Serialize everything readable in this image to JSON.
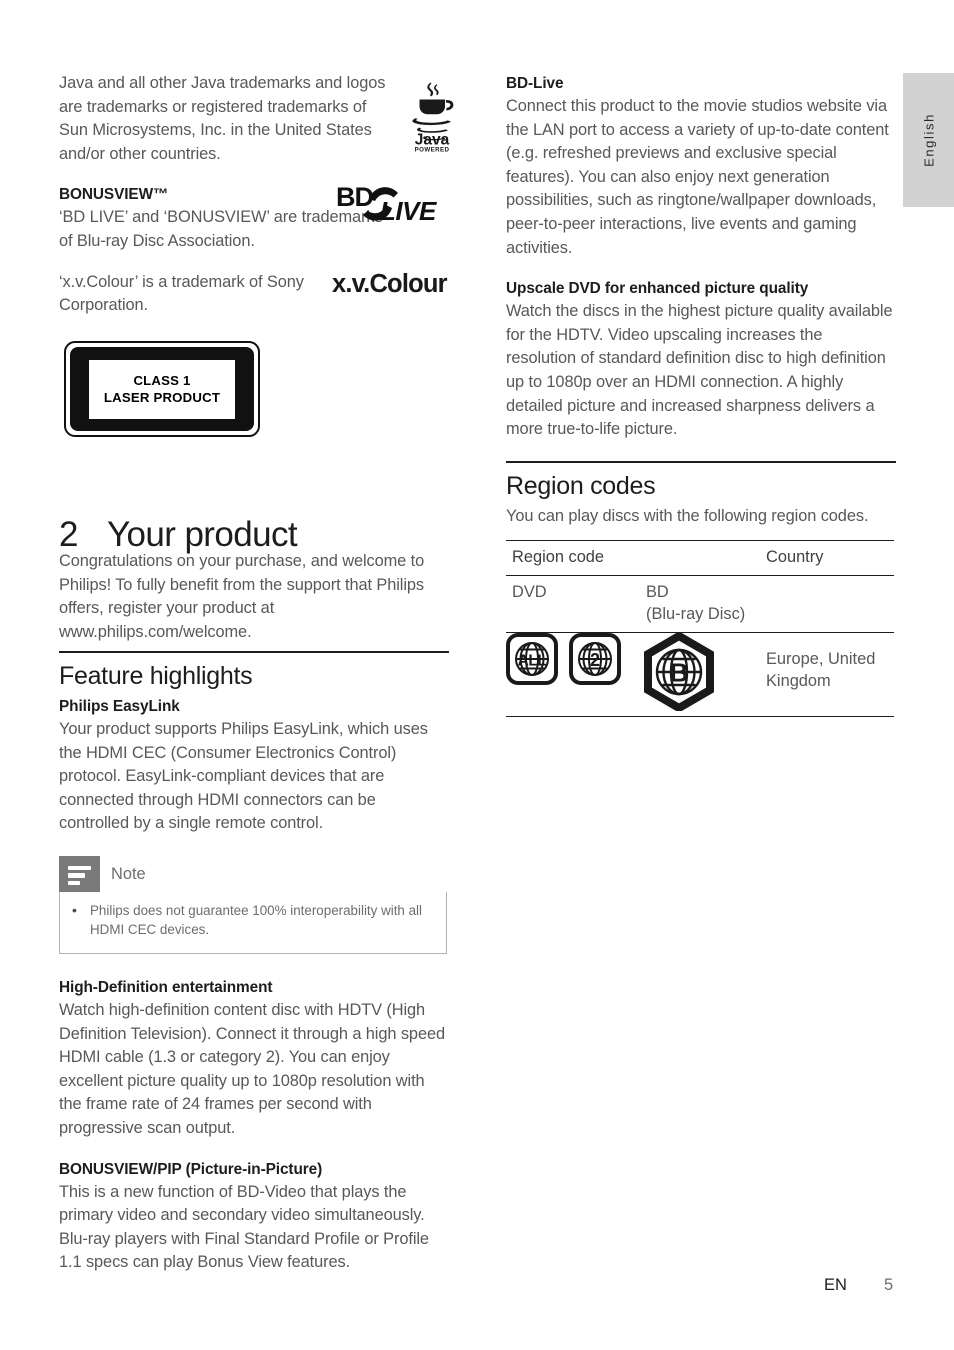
{
  "page": {
    "language_tab": "English",
    "footer_locale": "EN",
    "footer_page_number": "5",
    "accent_black": "#1d1d1d",
    "body_gray": "#58585a",
    "tab_gray": "#d2d2d2",
    "note_icon_gray": "#7a7a7a"
  },
  "left_column": {
    "trademarks": {
      "java_paragraph": "Java and all other Java trademarks and logos are trademarks or registered trademarks of Sun Microsystems, Inc. in the United States and/or other countries.",
      "java_logo_word": "Java",
      "java_logo_sub": "POWERED",
      "bonusview_heading": "BONUSVIEW™",
      "bonusview_paragraph": "‘BD LIVE’ and ‘BONUSVIEW’ are trademarks of Blu-ray Disc Association.",
      "bdlive_logo_bd": "BD",
      "bdlive_logo_live": "LIVE",
      "xvcolour_paragraph": "‘x.v.Colour’ is a trademark of Sony Corporation.",
      "xvcolour_logo": "x.v.Colour"
    },
    "laser_label": {
      "line1": "CLASS 1",
      "line2": "LASER PRODUCT"
    },
    "chapter": {
      "number": "2",
      "title": "Your product",
      "intro": "Congratulations on your purchase, and welcome to Philips! To fully benefit from the support that Philips offers, register your product at www.philips.com/welcome."
    },
    "feature_highlights": {
      "section_title": "Feature highlights",
      "items": [
        {
          "heading": "Philips EasyLink",
          "body": "Your product supports Philips EasyLink, which uses the HDMI CEC (Consumer Electronics Control) protocol. EasyLink-compliant devices that are connected through HDMI connectors can be controlled by a single remote control."
        },
        {
          "heading": "High-Definition entertainment",
          "body": "Watch high-definition content disc with HDTV (High Definition Television). Connect it through a high speed HDMI cable (1.3 or category 2). You can enjoy excellent picture quality up to 1080p resolution with the frame rate of 24 frames per second with progressive scan output."
        },
        {
          "heading": "BONUSVIEW/PIP (Picture-in-Picture)",
          "body": "This is a new function of BD-Video that plays the primary video and secondary video simultaneously. Blu-ray players with Final Standard Profile or Profile 1.1 specs can play Bonus View features."
        }
      ],
      "note": {
        "title": "Note",
        "bullet": "•",
        "items": [
          "Philips does not guarantee 100% interoperability with all HDMI CEC devices."
        ]
      }
    }
  },
  "right_column": {
    "items": [
      {
        "heading": "BD-Live",
        "body": "Connect this product to the movie studios website via the LAN port to access a variety of up-to-date content (e.g. refreshed previews and exclusive special features). You can also enjoy next generation possibilities, such as ringtone/wallpaper downloads, peer-to-peer interactions, live events and gaming activities."
      },
      {
        "heading": "Upscale DVD for enhanced picture quality",
        "body": "Watch the discs in the highest picture quality available for the HDTV. Video upscaling increases the resolution of standard definition disc to high definition up to 1080p over an HDMI connection. A highly detailed picture and increased sharpness delivers a more true-to-life picture."
      }
    ],
    "region_codes": {
      "section_title": "Region codes",
      "intro": "You can play discs with the following region codes.",
      "table": {
        "headers": [
          "Region code",
          "Country"
        ],
        "subheaders": [
          "DVD",
          "BD\n(Blu-ray Disc)"
        ],
        "subheader_dvd": "DVD",
        "subheader_bd_line1": "BD",
        "subheader_bd_line2": "(Blu-ray Disc)",
        "dvd_icons": [
          "ALL",
          "2"
        ],
        "bd_icon": "B",
        "country": "Europe, United Kingdom"
      }
    }
  }
}
